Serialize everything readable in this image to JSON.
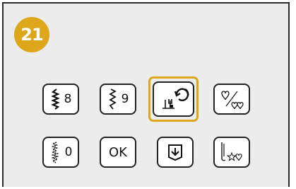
{
  "step": {
    "number": "21"
  },
  "keys": {
    "stitch_8": {
      "number": "8",
      "icon": "zigzag-stitch-icon"
    },
    "stitch_9": {
      "number": "9",
      "icon": "zigzag-stitch-icon"
    },
    "needle_position": {
      "icon": "needle-position-icon"
    },
    "character_decorative": {
      "icon": "heart-hearts-icon"
    },
    "stitch_0": {
      "number": "0",
      "icon": "satin-stitch-icon"
    },
    "ok": {
      "label": "OK"
    },
    "pocket": {
      "icon": "pocket-icon"
    },
    "decorative_stitches": {
      "icon": "needle-star-heart-icon"
    }
  },
  "colors": {
    "accent": "#dea61b",
    "panel_bg": "#ececec",
    "key_bg": "#ffffff",
    "border": "#222222"
  }
}
